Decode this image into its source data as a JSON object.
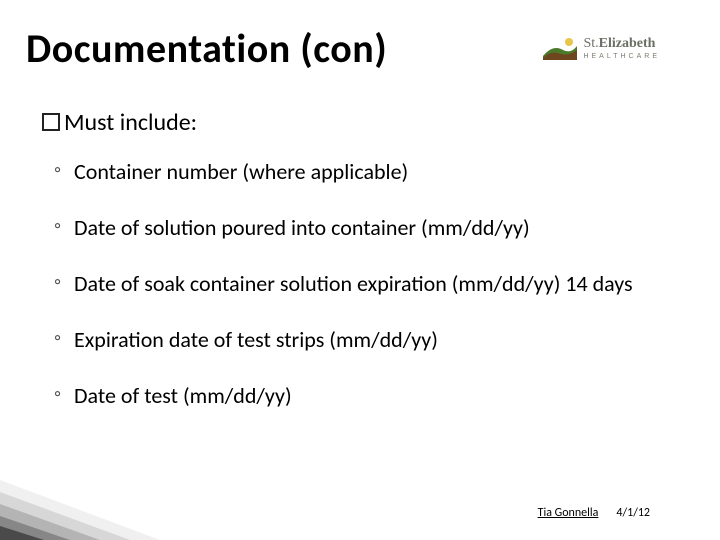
{
  "title": "Documentation (con)",
  "logo": {
    "name": "St.Elizabeth",
    "sub": "HEALTHCARE"
  },
  "intro_prefix": "Must",
  "intro_rest": " include:",
  "bullets": [
    "Container number (where applicable)",
    "Date of solution poured into container (mm/dd/yy)",
    "Date of soak container solution expiration (mm/dd/yy) 14 days",
    "Expiration date of test strips (mm/dd/yy)",
    "Date of test (mm/dd/yy)"
  ],
  "footer": {
    "author": "Tia Gonnella",
    "date": "4/1/12"
  }
}
